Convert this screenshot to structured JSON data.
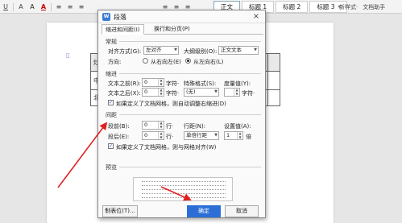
{
  "ribbon": {
    "tools": [
      "U",
      "A",
      "A",
      "A",
      "≡",
      "≡",
      "≡",
      "≡",
      "≡",
      "≡"
    ],
    "styles": [
      {
        "label": "正文",
        "active": true
      },
      {
        "label": "标题 1",
        "active": false
      },
      {
        "label": "标题 2",
        "active": false
      },
      {
        "label": "标题 3",
        "active": false
      }
    ],
    "new_style": "新样式·",
    "assistant": "文档助手"
  },
  "document": {
    "col_header_partial": "炒",
    "cells_left": [
      "中",
      "北"
    ]
  },
  "dialog": {
    "title": "段落",
    "app_icon_text": "W",
    "close": "×",
    "tabs": [
      "缩进和间距(I)",
      "换行和分页(P)"
    ],
    "general": {
      "section": "常规",
      "alignment_label": "对齐方式(G):",
      "alignment_value": "左对齐",
      "outline_label": "大纲级别(O):",
      "outline_value": "正文文本",
      "direction_label": "方向:",
      "rtl_label": "从右向左(E)",
      "ltr_label": "从左向右(L)",
      "direction_selected": "ltr"
    },
    "indent": {
      "section": "缩进",
      "before_label": "文本之前(R):",
      "before_value": "0",
      "before_unit": "字符·",
      "after_label": "文本之后(X):",
      "after_value": "0",
      "after_unit": "字符·",
      "special_label": "特殊格式(S):",
      "special_value": "(无)",
      "measure_label": "度量值(Y):",
      "measure_unit": "字符·",
      "grid_check_label": "如果定义了文档网格，则自动调整右缩进(D)",
      "grid_checked": true
    },
    "spacing": {
      "section": "间距",
      "before_label": "段前(B):",
      "before_value": "0",
      "before_unit": "行·",
      "after_label": "段后(E):",
      "after_value": "0",
      "after_unit": "行·",
      "line_label": "行距(N):",
      "line_value": "单倍行距",
      "set_label": "设置值(A):",
      "set_value": "1",
      "set_unit": "倍",
      "grid_check_label": "如果定义了文档网格，则与网格对齐(W)",
      "grid_checked": true
    },
    "preview": {
      "section": "预览",
      "lines": 5
    },
    "buttons": {
      "tabs_btn": "制表位(T)...",
      "ok": "确定",
      "cancel": "取消"
    }
  },
  "colors": {
    "accent": "#2b6fd6",
    "annotation_arrow": "#e02020"
  }
}
